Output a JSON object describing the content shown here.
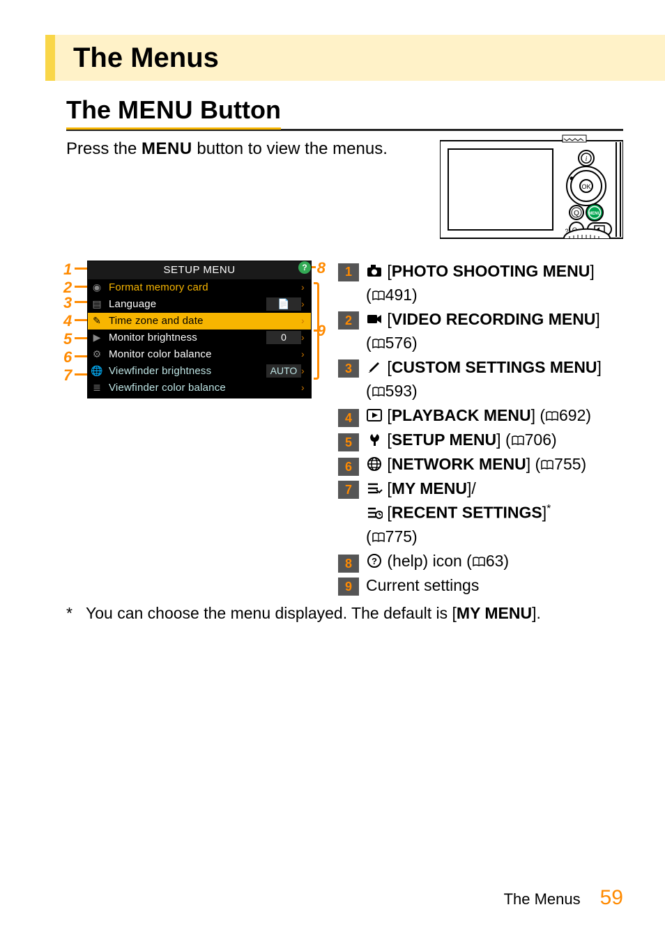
{
  "page": {
    "title": "The Menus",
    "section_heading_prefix": "The ",
    "section_heading_mono": "MENU",
    "section_heading_suffix": " Button",
    "intro_prefix": "Press the ",
    "intro_mono": "MENU",
    "intro_suffix": " button to view the menus.",
    "footnote_marker": "*",
    "footnote_text_prefix": "You can choose the menu displayed. The default is [",
    "footnote_text_bold": "MY MENU",
    "footnote_text_suffix": "].",
    "footer_label": "The Menus",
    "footer_page": "59"
  },
  "screenshot": {
    "header": "SETUP MENU",
    "rows": [
      {
        "label": "Format memory card",
        "value": "",
        "style": "hl-label"
      },
      {
        "label": "Language",
        "value": "icon",
        "style": ""
      },
      {
        "label": "Time zone and date",
        "value": "",
        "style": "hl-row"
      },
      {
        "label": "Monitor brightness",
        "value": "0",
        "style": ""
      },
      {
        "label": "Monitor color balance",
        "value": "",
        "style": ""
      },
      {
        "label": "Viewfinder brightness",
        "value": "AUTO",
        "style": "vf"
      },
      {
        "label": "Viewfinder color balance",
        "value": "",
        "style": "vf"
      }
    ],
    "callouts_left": [
      "1",
      "2",
      "3",
      "4",
      "5",
      "6",
      "7"
    ],
    "callouts_right": [
      "8",
      "9"
    ]
  },
  "legend": [
    {
      "n": "1",
      "icon": "camera",
      "bold": "PHOTO SHOOTING MENU",
      "ref": "491",
      "wrap": true
    },
    {
      "n": "2",
      "icon": "video",
      "bold": "VIDEO RECORDING MENU",
      "ref": "576",
      "wrap": true
    },
    {
      "n": "3",
      "icon": "pencil",
      "bold": "CUSTOM SETTINGS MENU",
      "ref": "593",
      "wrap": true
    },
    {
      "n": "4",
      "icon": "play",
      "bold": "PLAYBACK MENU",
      "ref": "692",
      "wrap": false
    },
    {
      "n": "5",
      "icon": "wrench",
      "bold": "SETUP MENU",
      "ref": "706",
      "wrap": false
    },
    {
      "n": "6",
      "icon": "globe",
      "bold": "NETWORK MENU",
      "ref": "755",
      "wrap": false
    },
    {
      "n": "7",
      "icon": "mymenu",
      "bold": "MY MENU",
      "slash": "/",
      "line2_icon": "recent",
      "line2_bold": "RECENT SETTINGS",
      "star": "*",
      "ref": "775",
      "wrap": true
    },
    {
      "n": "8",
      "icon": "help",
      "plain": " (help) icon ",
      "ref": "63",
      "wrap": false
    },
    {
      "n": "9",
      "plain_only": "Current settings"
    }
  ]
}
